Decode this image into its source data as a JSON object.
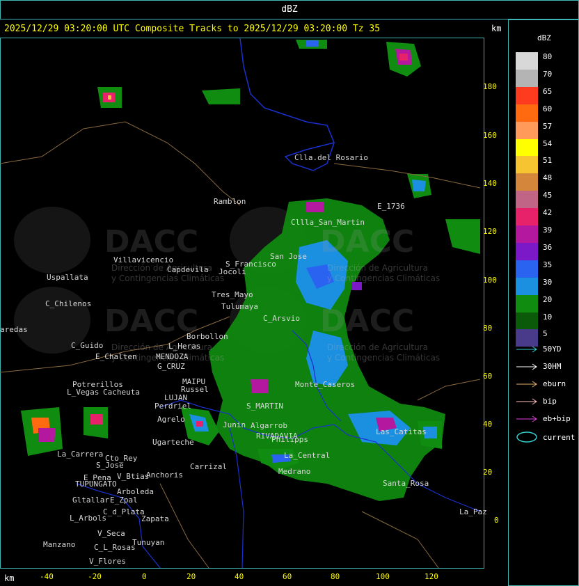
{
  "header": {
    "title": "dBZ",
    "subtitle": "2025/12/29 03:20:00 UTC Composite Tracks to 2025/12/29 03:20:00 Tz 35",
    "km_top": "km",
    "km_bottom": "km"
  },
  "axes": {
    "y_ticks": [
      "180",
      "160",
      "140",
      "120",
      "100",
      "80",
      "60",
      "40",
      "20",
      "0"
    ],
    "x_ticks": [
      "-40",
      "-20",
      "0",
      "20",
      "40",
      "60",
      "80",
      "100",
      "120"
    ]
  },
  "places": [
    "Clla.del Rosario",
    "Ramblon",
    "Villavicencio",
    "Uspallata",
    "Capdevila",
    "S_Francisco",
    "Jocoli",
    "San Jose",
    "Tres_Mayo",
    "Tulumaya",
    "C_Chilenos",
    "aredas",
    "C_Arsvio",
    "C_Guido",
    "L_Heras",
    "Borbollon",
    "E_Chalten",
    "MENDOZA",
    "G_CRUZ",
    "Potrerillos",
    "L_Vegas",
    "Cacheuta",
    "MAIPU",
    "LUJAN",
    "Russel",
    "Perdriel",
    "Agrelo",
    "S_MARTIN",
    "Ugarteche",
    "Carrizal",
    "RIVADAVIA",
    "La_Carrera",
    "Cto_Rey",
    "S_Jose",
    "E_Pena",
    "TUPUNGATO",
    "V_Btias",
    "Anchoris",
    "Arboleda",
    "Gltallar",
    "E_Zpal",
    "L_Arbols",
    "C_d_Plata",
    "Zapata",
    "V_Seca",
    "Tunuyan",
    "C_L_Rosas",
    "Manzano",
    "V_Flores",
    "Algarrob",
    "Junin",
    "La_Central",
    "Medrano",
    "Philipps",
    "Monte_Caseros",
    "La_Paz",
    "E_1736",
    "Santa_Rosa",
    "Las_Catitas",
    "Cllla_San_Martin"
  ],
  "watermark": {
    "brand": "DACC",
    "line1": "Dirección de Agricultura",
    "line2": "y Contingencias Climáticas"
  },
  "legend": {
    "title": "dBZ",
    "scale": [
      {
        "label": "80",
        "color": "#d8d8d8"
      },
      {
        "label": "70",
        "color": "#b4b4b4"
      },
      {
        "label": "65",
        "color": "#ff3b1f"
      },
      {
        "label": "60",
        "color": "#ff6a10"
      },
      {
        "label": "57",
        "color": "#ff9a5a"
      },
      {
        "label": "54",
        "color": "#ffff00"
      },
      {
        "label": "51",
        "color": "#f7c431"
      },
      {
        "label": "48",
        "color": "#d4873a"
      },
      {
        "label": "45",
        "color": "#c06585"
      },
      {
        "label": "42",
        "color": "#e8226a"
      },
      {
        "label": "39",
        "color": "#b4189e"
      },
      {
        "label": "36",
        "color": "#7b19c8"
      },
      {
        "label": "35",
        "color": "#2a63f0"
      },
      {
        "label": "30",
        "color": "#1b8fe0"
      },
      {
        "label": "20",
        "color": "#108c10"
      },
      {
        "label": "10",
        "color": "#0a5a0a"
      },
      {
        "label": "5",
        "color": "#4a3a8a"
      }
    ],
    "tracks": [
      {
        "label": "50YD",
        "color": "#33cccc"
      },
      {
        "label": "30HM",
        "color": "#ffffff"
      },
      {
        "label": "eburn",
        "color": "#e8b070"
      },
      {
        "label": "bip",
        "color": "#ffc0c0"
      },
      {
        "label": "eb+bip",
        "color": "#e040e0"
      }
    ],
    "current_label": "current",
    "current_color": "#33cccc"
  },
  "colors": {
    "frame": "#3fb6b6",
    "tick_text": "#ffff00",
    "boundary": "#1a30d0",
    "road": "#8a6a40"
  }
}
